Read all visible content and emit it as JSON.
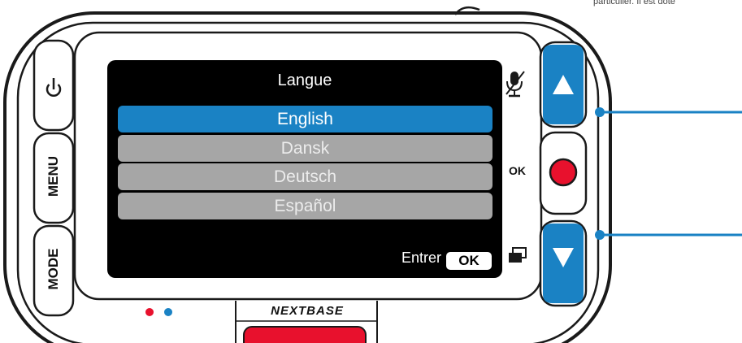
{
  "screen": {
    "title": "Langue",
    "languages": [
      {
        "label": "English",
        "selected": true
      },
      {
        "label": "Dansk",
        "selected": false
      },
      {
        "label": "Deutsch",
        "selected": false
      },
      {
        "label": "Español",
        "selected": false
      }
    ],
    "enter_label": "Entrer",
    "ok_chip": "OK"
  },
  "left_buttons": {
    "power_icon": "power-icon",
    "menu_label": "MENU",
    "mode_label": "MODE"
  },
  "right_side": {
    "mic_icon": "microphone-muted-icon",
    "ok_label": "OK",
    "screens_icon": "screen-toggle-icon"
  },
  "brand": "NEXTBASE",
  "top_text": "particulier. Il est doté",
  "colors": {
    "accent_blue": "#1a82c4",
    "record_red": "#e8112d",
    "indicator_line": "#1a82c4"
  }
}
